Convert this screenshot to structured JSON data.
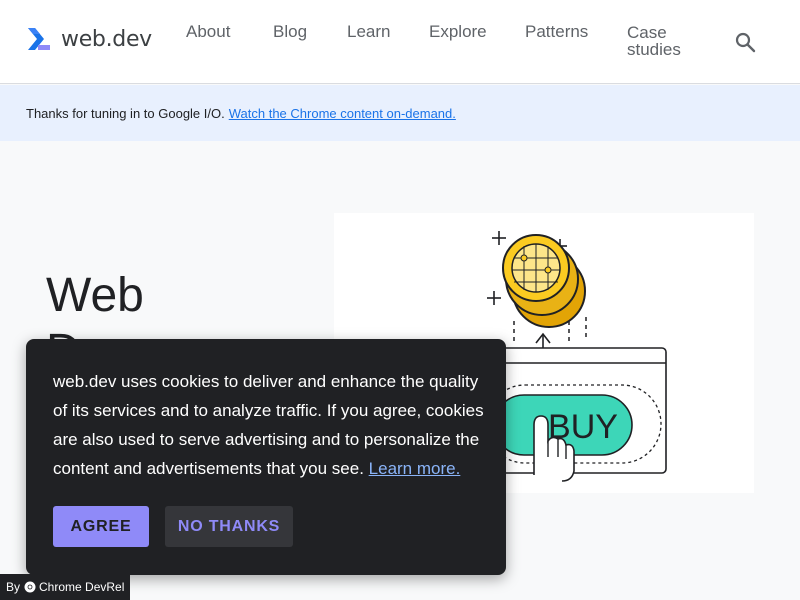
{
  "header": {
    "logo_text": "web.dev",
    "nav": [
      {
        "label": "About"
      },
      {
        "label": "Blog"
      },
      {
        "label": "Learn"
      },
      {
        "label": "Explore"
      },
      {
        "label": "Patterns"
      },
      {
        "label": "Case studies",
        "line1": "Case",
        "line2": "studies"
      }
    ],
    "search_icon": "search-icon"
  },
  "banner": {
    "text": "Thanks for tuning in to Google I/O.",
    "link": "Watch the Chrome content on-demand."
  },
  "hero": {
    "title_line1": "Web",
    "title_line2": "D",
    "illustration_label": "BUY"
  },
  "cookie_dialog": {
    "text": "web.dev uses cookies to deliver and enhance the quality of its services and to analyze traffic. If you agree, cookies are also used to serve advertising and to personalize the content and advertisements that you see.",
    "link": "Learn more.",
    "agree_label": "AGREE",
    "no_thanks_label": "NO THANKS"
  },
  "attribution": {
    "prefix": "By",
    "label": "Chrome DevRel"
  },
  "colors": {
    "accent_button": "#8f8af8",
    "dialog_bg": "#202124",
    "banner_bg": "#e8f0fe",
    "link": "#1a73e8",
    "buy_button": "#3dd6b8",
    "coin": "#fbcb21"
  }
}
